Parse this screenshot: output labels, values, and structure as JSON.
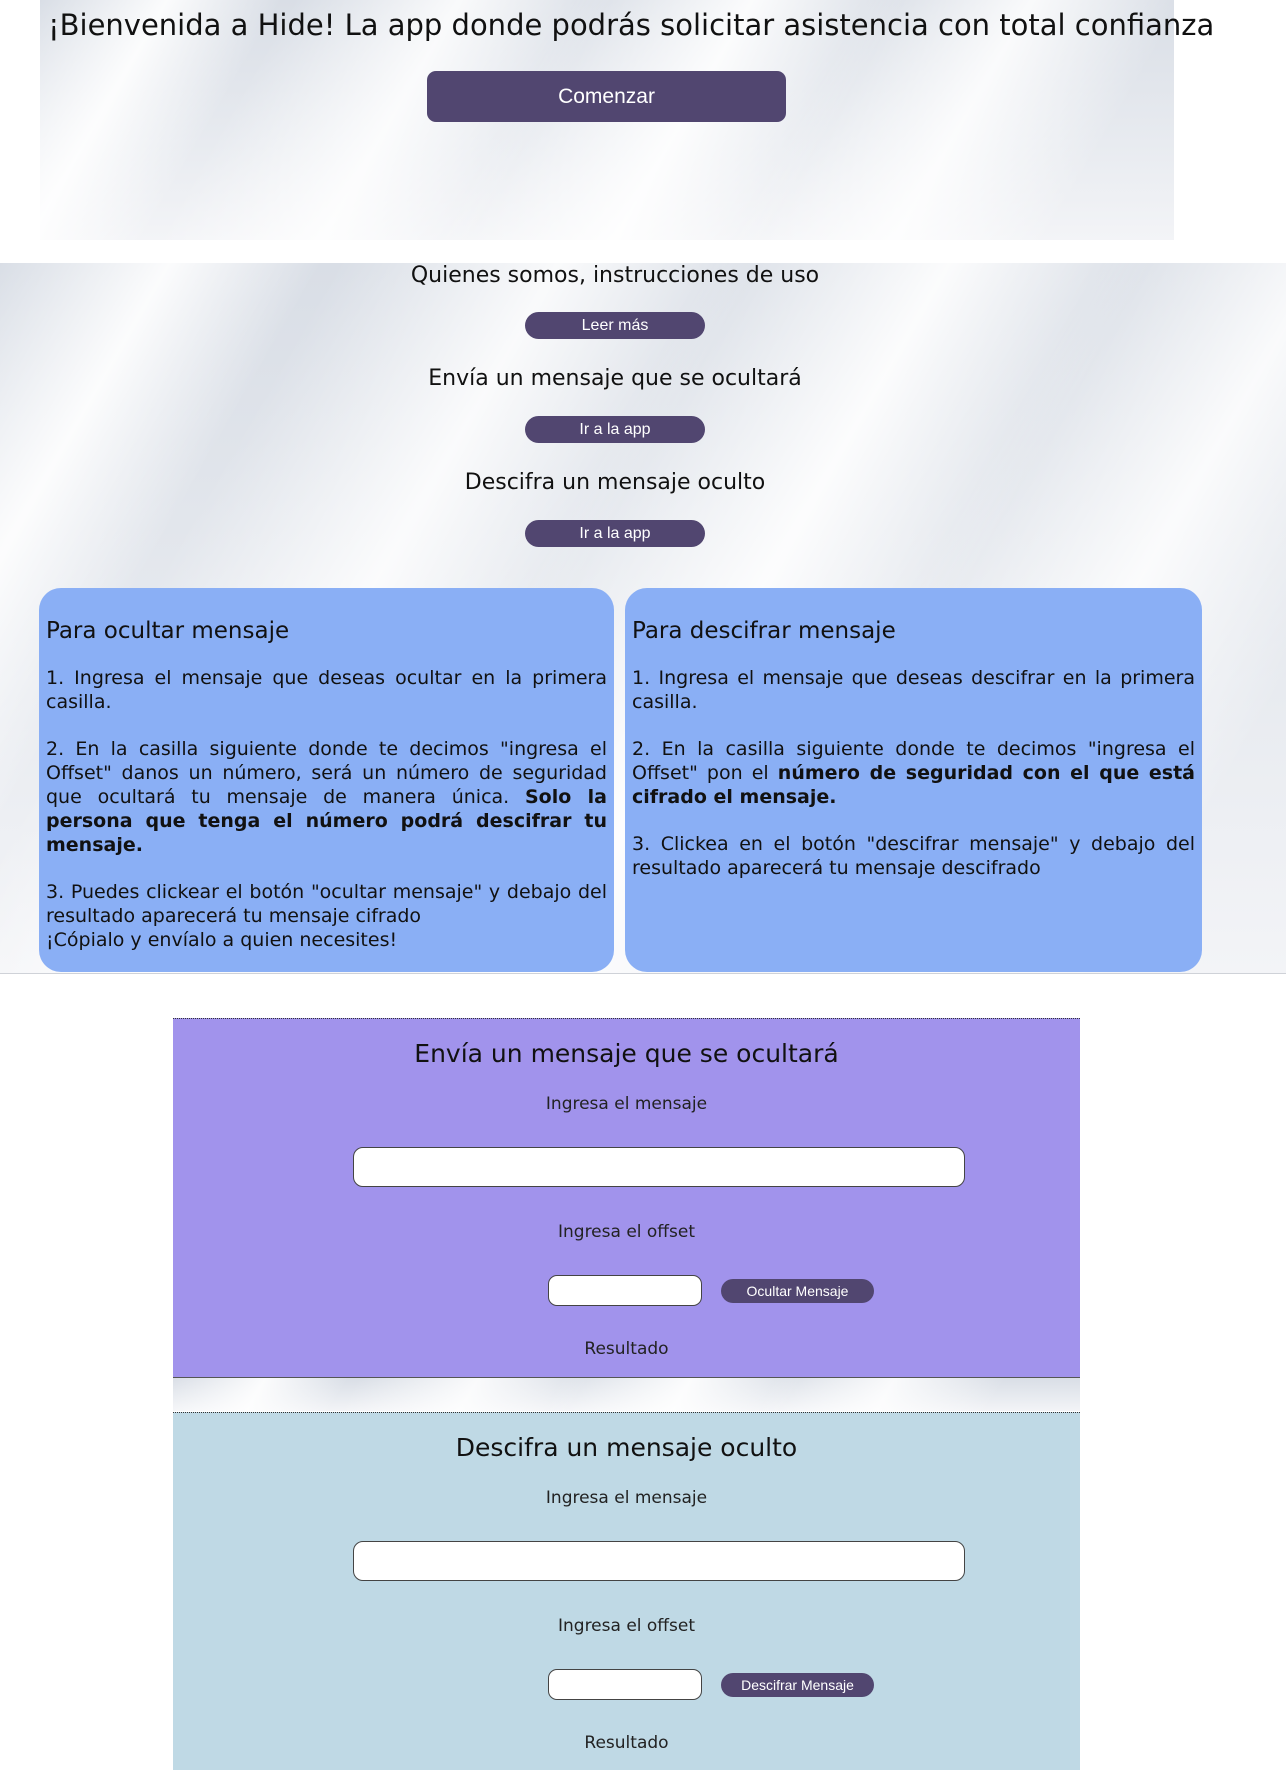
{
  "hero": {
    "title": "¡Bienvenida a Hide! La app donde podrás solicitar asistencia con total confianza",
    "start_button": "Comenzar"
  },
  "sections": [
    {
      "heading": "Quienes somos, instrucciones de uso",
      "button": "Leer más"
    },
    {
      "heading": "Envía un mensaje que se ocultará",
      "button": "Ir a la app"
    },
    {
      "heading": "Descifra un mensaje oculto",
      "button": "Ir a la app"
    }
  ],
  "hide_card": {
    "title": "Para ocultar mensaje",
    "step1": "1. Ingresa el mensaje que deseas ocultar en la primera casilla.",
    "step2": "2. En la casilla siguiente donde te decimos \"ingresa el Offset\" danos un número, será un número de seguridad que ocultará tu mensaje de manera única.",
    "step2_bold": "Solo la persona que tenga el número podrá descifrar tu mensaje.",
    "step3": "3. Puedes clickear el botón \"ocultar mensaje\" y debajo del resultado aparecerá tu mensaje cifrado",
    "step3_line2": "¡Cópialo y envíalo a quien necesites!"
  },
  "decrypt_card": {
    "title": "Para descifrar mensaje",
    "step1": "1. Ingresa el mensaje que deseas descifrar en la primera casilla.",
    "step2": "2. En la casilla siguiente donde te decimos \"ingresa el Offset\" pon el",
    "step2_bold": "número de seguridad con el que está cifrado el mensaje.",
    "step3": "3. Clickea en el botón \"descifrar mensaje\" y debajo del resultado aparecerá tu mensaje descifrado"
  },
  "hide_panel": {
    "title": "Envía un mensaje que se ocultará",
    "message_label": "Ingresa el mensaje",
    "message_value": "",
    "offset_label": "Ingresa el offset",
    "offset_value": "",
    "button": "Ocultar Mensaje",
    "result_label": "Resultado"
  },
  "decrypt_panel": {
    "title": "Descifra un mensaje oculto",
    "message_label": "Ingresa el mensaje",
    "message_value": "",
    "offset_label": "Ingresa el offset",
    "offset_value": "",
    "button": "Descifrar Mensaje",
    "result_label": "Resultado"
  },
  "colors": {
    "button": "#514670",
    "card": "#8aaff5",
    "hide_panel": "#a193ec",
    "decrypt_panel": "#bfd9e5"
  }
}
